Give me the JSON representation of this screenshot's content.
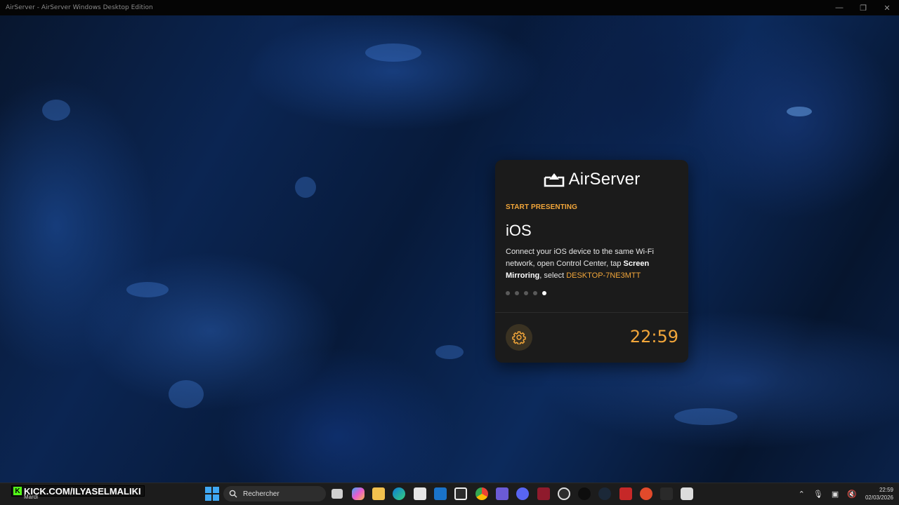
{
  "window": {
    "title": "AirServer - AirServer Windows Desktop Edition",
    "minimize_glyph": "—",
    "maximize_glyph": "❐",
    "close_glyph": "✕"
  },
  "card": {
    "logo_text": "AirServer",
    "eyebrow": "START PRESENTING",
    "platform": "iOS",
    "desc_part1": "Connect your iOS device to the same Wi-Fi network, open Control Center, tap ",
    "desc_bold1": "Screen Mirroring",
    "desc_part2": ", select ",
    "desc_device": "DESKTOP-7NE3MTT",
    "dots_total": 5,
    "dots_active_index": 4,
    "clock": "22:59",
    "accent_color": "#f2a63a"
  },
  "overlay": {
    "watermark_text": "KICK.COM/ILYASELMALIKI",
    "weather_label": "Mardi"
  },
  "taskbar": {
    "search_placeholder": "Rechercher",
    "tray_time": "22:59",
    "tray_date": "02/03/2026"
  }
}
